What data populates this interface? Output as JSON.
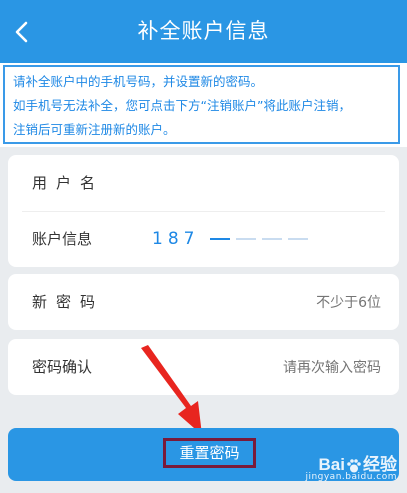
{
  "header": {
    "title": "补全账户信息"
  },
  "notice": {
    "lines": [
      "请补全账户中的手机号码，并设置新的密码。",
      "如手机号无法补全，您可点击下方“注销账户”将此账户注销，",
      "注销后可重新注册新的账户。"
    ]
  },
  "account_card": {
    "username_label": "用户名",
    "info_label": "账户信息",
    "phone_prefix": "187"
  },
  "password_card": {
    "label": "新密码",
    "placeholder": "不少于6位"
  },
  "confirm_card": {
    "label": "密码确认",
    "placeholder": "请再次输入密码"
  },
  "submit": {
    "label": "重置密码"
  },
  "watermark": {
    "brand_left": "Bai",
    "brand_right": "经验",
    "url": "jingyan.baidu.com"
  },
  "colors": {
    "accent": "#2a96e4",
    "highlight_box": "#7a1a3a",
    "arrow": "#e8251f"
  }
}
